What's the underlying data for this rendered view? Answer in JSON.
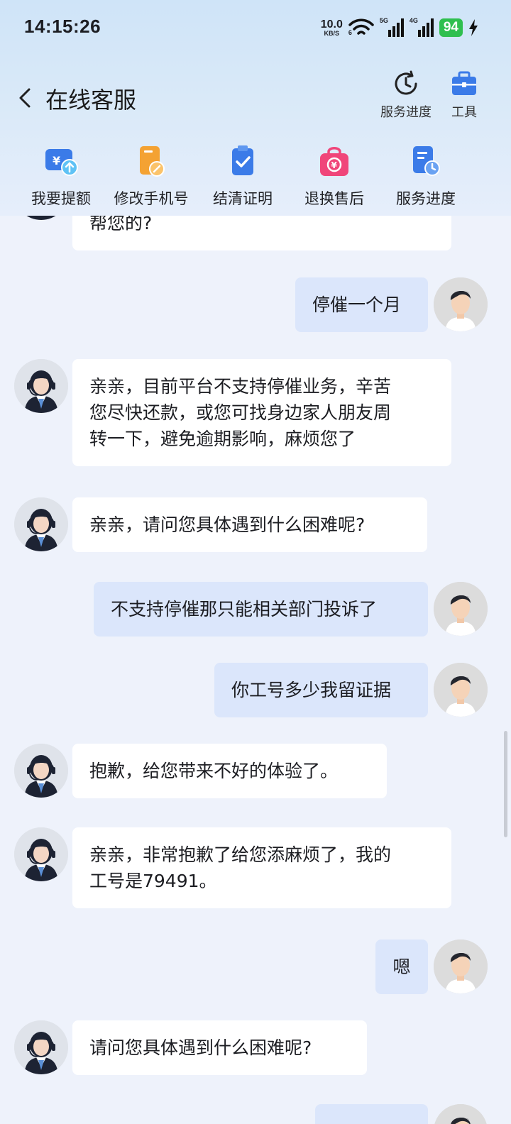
{
  "status_bar": {
    "time": "14:15:26",
    "net_speed_value": "10.0",
    "net_speed_unit": "KB/S",
    "wifi_tag": "6",
    "sig1_tag": "5G",
    "sig2_tag": "4G",
    "battery": "94"
  },
  "nav": {
    "title": "在线客服",
    "action1_label": "服务进度",
    "action2_label": "工具"
  },
  "quick": {
    "item1": "我要提额",
    "item2": "修改手机号",
    "item3": "结清证明",
    "item4": "退换售后",
    "item5": "服务进度"
  },
  "colors": {
    "accent": "#3b7be8",
    "orange": "#f4a233",
    "pink": "#f0457a",
    "user_bubble": "#dbe6fb"
  },
  "messages": {
    "m0": "帮您的?",
    "m1": "停催一个月",
    "m2a": "亲亲，目前平台不支持停催业务，辛苦",
    "m2b": "您尽快还款，或您可找身边家人朋友周",
    "m2c": "转一下，避免逾期影响，麻烦您了",
    "m3": "亲亲，请问您具体遇到什么困难呢?",
    "m4": "不支持停催那只能相关部门投诉了",
    "m5": "你工号多少我留证据",
    "m6": "抱歉，给您带来不好的体验了。",
    "m7a": "亲亲，非常抱歉了给您添麻烦了，我的",
    "m7b": "工号是79491。",
    "m8": "嗯",
    "m9": "请问您具体遇到什么困难呢?"
  }
}
